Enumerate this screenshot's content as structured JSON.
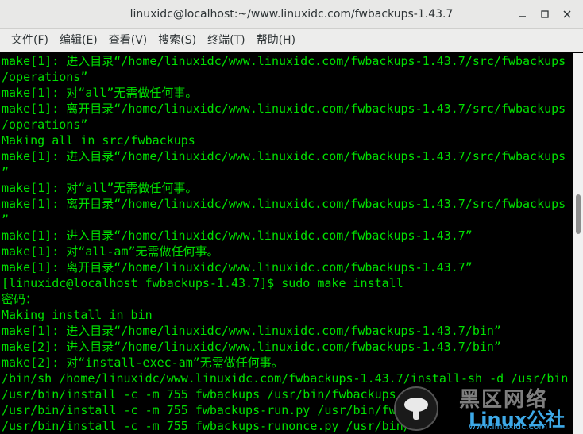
{
  "window": {
    "title": "linuxidc@localhost:~/www.linuxidc.com/fwbackups-1.43.7",
    "minimize_icon": "minimize-icon",
    "maximize_icon": "maximize-icon",
    "close_icon": "close-icon"
  },
  "menu": {
    "items": [
      {
        "label": "文件(F)"
      },
      {
        "label": "编辑(E)"
      },
      {
        "label": "查看(V)"
      },
      {
        "label": "搜索(S)"
      },
      {
        "label": "终端(T)"
      },
      {
        "label": "帮助(H)"
      }
    ]
  },
  "terminal": {
    "lines": [
      "make[1]: 进入目录“/home/linuxidc/www.linuxidc.com/fwbackups-1.43.7/src/fwbackups",
      "/operations”",
      "make[1]: 对“all”无需做任何事。",
      "make[1]: 离开目录“/home/linuxidc/www.linuxidc.com/fwbackups-1.43.7/src/fwbackups",
      "/operations”",
      "Making all in src/fwbackups",
      "make[1]: 进入目录“/home/linuxidc/www.linuxidc.com/fwbackups-1.43.7/src/fwbackups",
      "”",
      "make[1]: 对“all”无需做任何事。",
      "make[1]: 离开目录“/home/linuxidc/www.linuxidc.com/fwbackups-1.43.7/src/fwbackups",
      "”",
      "make[1]: 进入目录“/home/linuxidc/www.linuxidc.com/fwbackups-1.43.7”",
      "make[1]: 对“all-am”无需做任何事。",
      "make[1]: 离开目录“/home/linuxidc/www.linuxidc.com/fwbackups-1.43.7”",
      "[linuxidc@localhost fwbackups-1.43.7]$ sudo make install",
      "密码：",
      "Making install in bin",
      "make[1]: 进入目录“/home/linuxidc/www.linuxidc.com/fwbackups-1.43.7/bin”",
      "make[2]: 进入目录“/home/linuxidc/www.linuxidc.com/fwbackups-1.43.7/bin”",
      "make[2]: 对“install-exec-am”无需做任何事。",
      "/bin/sh /home/linuxidc/www.linuxidc.com/fwbackups-1.43.7/install-sh -d /usr/bin",
      "/usr/bin/install -c -m 755 fwbackups /usr/bin/fwbackups",
      "/usr/bin/install -c -m 755 fwbackups-run.py /usr/bin/fwb",
      "/usr/bin/install -c -m 755 fwbackups-runonce.py /usr/bin/"
    ]
  },
  "watermark": {
    "chinese": "黑区网络",
    "brand": "Linux公社",
    "site": "www.linuxidc.com"
  },
  "colors": {
    "terminal_fg": "#00e000",
    "terminal_bg": "#000000",
    "titlebar_bg": "#e8e8e7"
  }
}
